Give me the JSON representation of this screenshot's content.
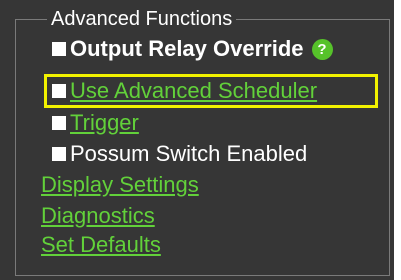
{
  "group": {
    "title": "Advanced Functions"
  },
  "options": [
    {
      "label": "Output Relay Override",
      "checked": false,
      "style": "bold-white",
      "has_help_icon": true,
      "help_icon": "question-icon"
    },
    {
      "label": "Use Advanced Scheduler",
      "checked": false,
      "style": "link",
      "highlighted": true
    },
    {
      "label": "Trigger",
      "checked": false,
      "style": "link"
    },
    {
      "label": "Possum Switch Enabled",
      "checked": false,
      "style": "white"
    }
  ],
  "help_icon_glyph": "?",
  "links": [
    {
      "label": "Display Settings"
    },
    {
      "label": "Diagnostics"
    },
    {
      "label": "Set Defaults"
    }
  ],
  "colors": {
    "background": "#363636",
    "link": "#62d13a",
    "help_icon": "#56c22a",
    "highlight_box": "#f2f200",
    "text": "#ffffff"
  }
}
